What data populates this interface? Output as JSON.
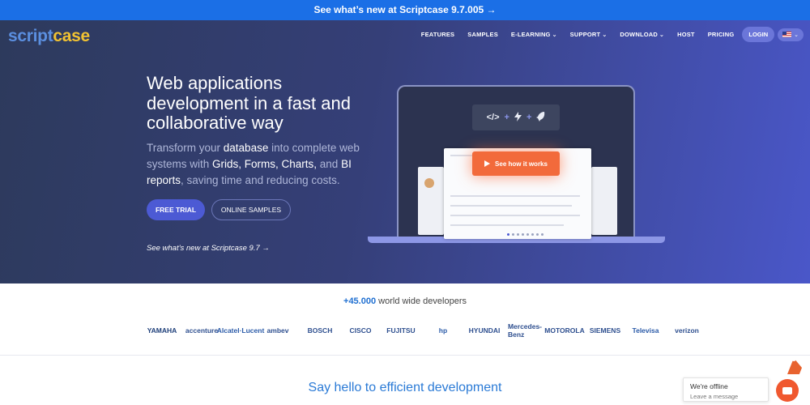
{
  "announcement": "See what’s new at Scriptcase 9.7.005 →",
  "logo": {
    "part1": "script",
    "part2": "case"
  },
  "nav": {
    "items": [
      {
        "label": "FEATURES",
        "has_dropdown": false
      },
      {
        "label": "SAMPLES",
        "has_dropdown": false
      },
      {
        "label": "E-LEARNING",
        "has_dropdown": true
      },
      {
        "label": "SUPPORT",
        "has_dropdown": true
      },
      {
        "label": "DOWNLOAD",
        "has_dropdown": true
      },
      {
        "label": "HOST",
        "has_dropdown": false
      },
      {
        "label": "PRICING",
        "has_dropdown": false
      }
    ],
    "login": "LOGIN",
    "language_icon": "us-flag-icon"
  },
  "hero": {
    "headline": "Web applications development in a fast and collaborative way",
    "sub_pre": "Transform your ",
    "sub_b1": "database",
    "sub_mid1": " into complete web systems with ",
    "sub_b2": "Grids, Forms, Charts,",
    "sub_mid2": " and ",
    "sub_b3": "BI reports",
    "sub_post": ", saving time and reducing costs.",
    "free_trial": "FREE TRIAL",
    "online_samples": "ONLINE SAMPLES",
    "whats_new": "See what’s new at Scriptcase 9.7 →",
    "icons_row": {
      "code": "</>",
      "plus1": "+",
      "plus2": "+"
    },
    "video_button": "See how it works"
  },
  "developers": {
    "count": "+45.000",
    "text": " world wide developers"
  },
  "company_logos": [
    {
      "name": "YAMAHA",
      "color": "#1e3f7a"
    },
    {
      "name": "accenture",
      "color": "#2e4f8f"
    },
    {
      "name": "Alcatel·Lucent",
      "color": "#2a5aa8"
    },
    {
      "name": "ambev",
      "color": "#2e4f8f"
    },
    {
      "name": "BOSCH",
      "color": "#2e4f8f"
    },
    {
      "name": "CISCO",
      "color": "#2e4f8f"
    },
    {
      "name": "FUJITSU",
      "color": "#2e4f8f"
    },
    {
      "name": "hp",
      "color": "#2a5aa8"
    },
    {
      "name": "HYUNDAI",
      "color": "#2e4f8f"
    },
    {
      "name": "Mercedes-Benz",
      "color": "#2e4f8f"
    },
    {
      "name": "MOTOROLA",
      "color": "#2e4f8f"
    },
    {
      "name": "SIEMENS",
      "color": "#2e4f8f"
    },
    {
      "name": "Televisa",
      "color": "#2a5aa8"
    },
    {
      "name": "verizon",
      "color": "#2e4f8f"
    }
  ],
  "section_title": "Say hello to efficient development",
  "chat": {
    "status": "We're offline",
    "action": "Leave a message"
  },
  "colors": {
    "accent": "#4c5ad4",
    "announce": "#1b6fe6",
    "cta_orange": "#f26a3b",
    "logo_blue": "#5b8fe0",
    "logo_yellow": "#f1c232"
  }
}
